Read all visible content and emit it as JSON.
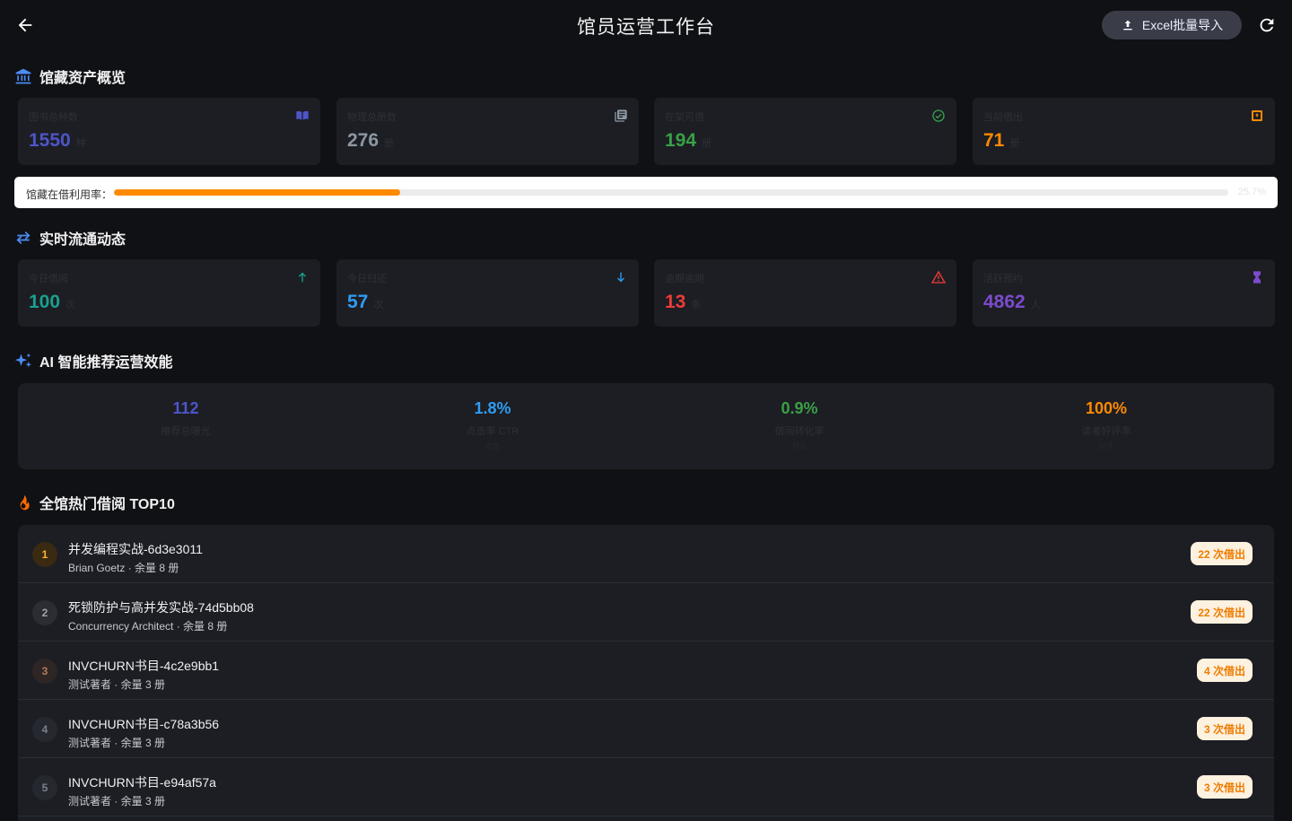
{
  "header": {
    "title": "馆员运营工作台",
    "import_label": "Excel批量导入"
  },
  "collection": {
    "title": "馆藏资产概览",
    "cards": [
      {
        "label": "图书总种数",
        "value": "1550",
        "unit": "种",
        "color": "#4e55c8",
        "icon": "book-open-icon"
      },
      {
        "label": "物理总册数",
        "value": "276",
        "unit": "册",
        "color": "#8c97a3",
        "icon": "library-books-icon"
      },
      {
        "label": "在架可借",
        "value": "194",
        "unit": "册",
        "color": "#39a046",
        "icon": "check-circle-icon"
      },
      {
        "label": "当前借出",
        "value": "71",
        "unit": "册",
        "color": "#ff8a00",
        "icon": "outbox-icon"
      }
    ],
    "utilization": {
      "label": "馆藏在借利用率：",
      "percent": 25.7,
      "percent_text": "25.7%"
    }
  },
  "realtime": {
    "title": "实时流通动态",
    "cards": [
      {
        "label": "今日借阅",
        "value": "100",
        "unit": "次",
        "color": "#1aa08e",
        "icon": "arrow-up-icon"
      },
      {
        "label": "今日归还",
        "value": "57",
        "unit": "次",
        "color": "#2f9cf3",
        "icon": "arrow-down-icon"
      },
      {
        "label": "逾期逾期",
        "value": "13",
        "unit": "条",
        "color": "#ee3b38",
        "icon": "warning-icon"
      },
      {
        "label": "活跃预约",
        "value": "4862",
        "unit": "人",
        "color": "#7c4bcc",
        "icon": "hourglass-icon"
      }
    ]
  },
  "ai": {
    "title": "AI 智能推荐运营效能",
    "metrics": [
      {
        "value": "112",
        "label": "推荐总曝光",
        "sub": "",
        "color": "#4e55c8"
      },
      {
        "value": "1.8%",
        "label": "点击率 CTR",
        "sub": "点击",
        "color": "#2f9cf3"
      },
      {
        "value": "0.9%",
        "label": "借阅转化率",
        "sub": "转化",
        "color": "#39a046"
      },
      {
        "value": "100%",
        "label": "读者好评率",
        "sub": "好评",
        "color": "#ff8a00"
      }
    ]
  },
  "top10": {
    "title": "全馆热门借阅 TOP10",
    "items": [
      {
        "rank": "1",
        "title": "并发编程实战-6d3e3011",
        "meta": "Brian Goetz · 余量 8 册",
        "badge": "22 次借出"
      },
      {
        "rank": "2",
        "title": "死锁防护与高并发实战-74d5bb08",
        "meta": "Concurrency Architect · 余量 8 册",
        "badge": "22 次借出"
      },
      {
        "rank": "3",
        "title": "INVCHURN书目-4c2e9bb1",
        "meta": "测试著者 · 余量 3 册",
        "badge": "4 次借出"
      },
      {
        "rank": "4",
        "title": "INVCHURN书目-c78a3b56",
        "meta": "测试著者 · 余量 3 册",
        "badge": "3 次借出"
      },
      {
        "rank": "5",
        "title": "INVCHURN书目-e94af57a",
        "meta": "测试著者 · 余量 3 册",
        "badge": "3 次借出"
      }
    ]
  }
}
